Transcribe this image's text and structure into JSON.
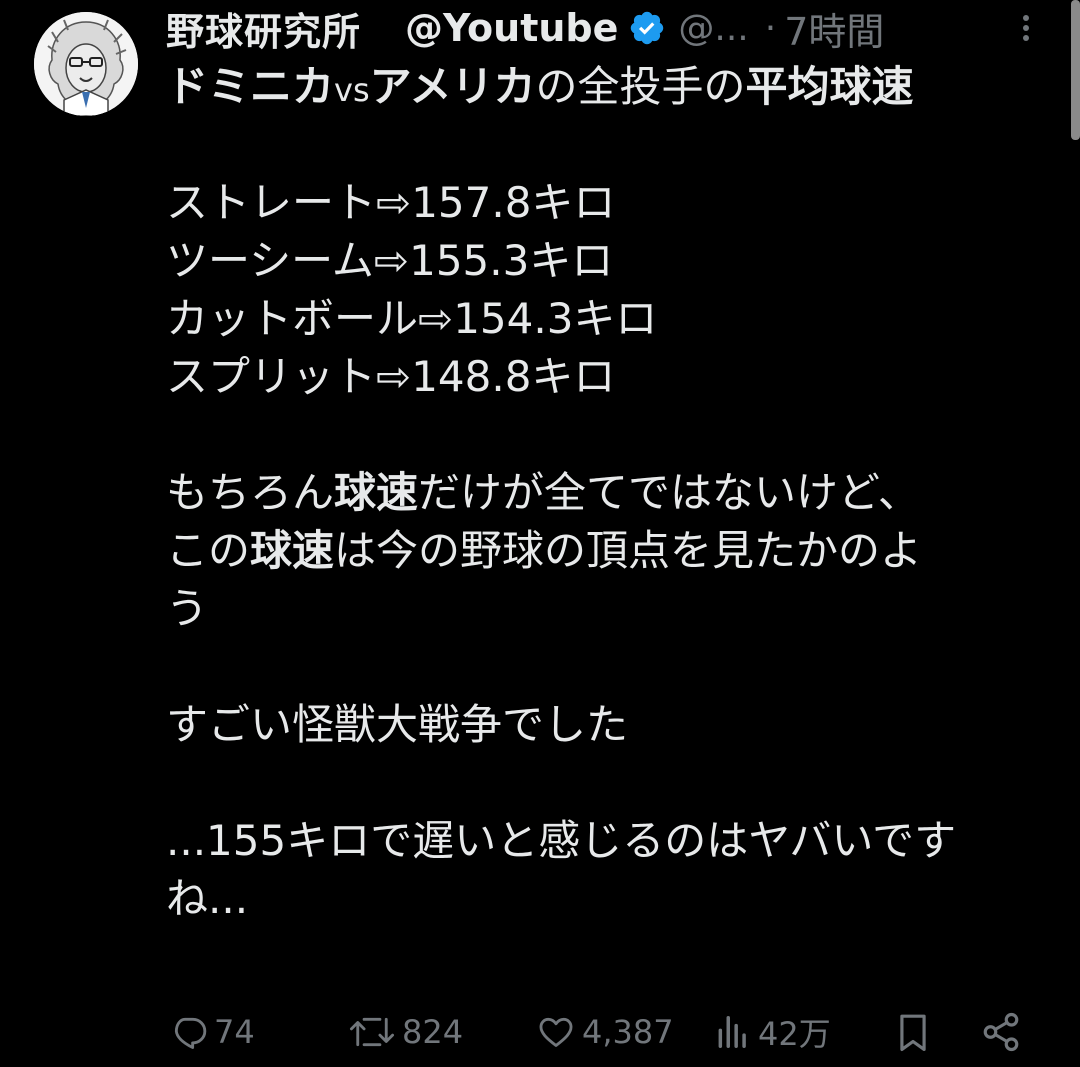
{
  "author": {
    "display_name": "野球研究所",
    "channel_tag": "@Youtube",
    "handle": "@...",
    "separator": "·",
    "time": "7時間"
  },
  "post": {
    "l1a": "ドミニカ",
    "l1b": "vs",
    "l1c": "アメリカ",
    "l1d": "の全投手の",
    "l1e": "平均球速",
    "l2": "ストレート⇨157.8キロ",
    "l3": "ツーシーム⇨155.3キロ",
    "l4": "カットボール⇨154.3キロ",
    "l5": "スプリット⇨148.8キロ",
    "l6a": "もちろん",
    "l6b": "球速",
    "l6c": "だけが全てではないけど、",
    "l7a": "この",
    "l7b": "球速",
    "l7c": "は今の野球の頂点を見たかのよ",
    "l8": "う",
    "l9": "すごい怪獣大戦争でした",
    "l10": "...155キロで遅いと感じるのはヤバいです",
    "l11": "ね..."
  },
  "actions": {
    "replies": "74",
    "reposts": "824",
    "likes": "4,387",
    "views": "42万"
  },
  "colors": {
    "background": "#000000",
    "text": "#e7e9ea",
    "secondary": "#71767b",
    "verified": "#1d9bf0"
  },
  "icons": [
    "avatar-lion-illustration",
    "verified-badge-icon",
    "more-options-icon",
    "reply-icon",
    "repost-icon",
    "like-icon",
    "views-icon",
    "bookmark-icon",
    "share-icon"
  ]
}
